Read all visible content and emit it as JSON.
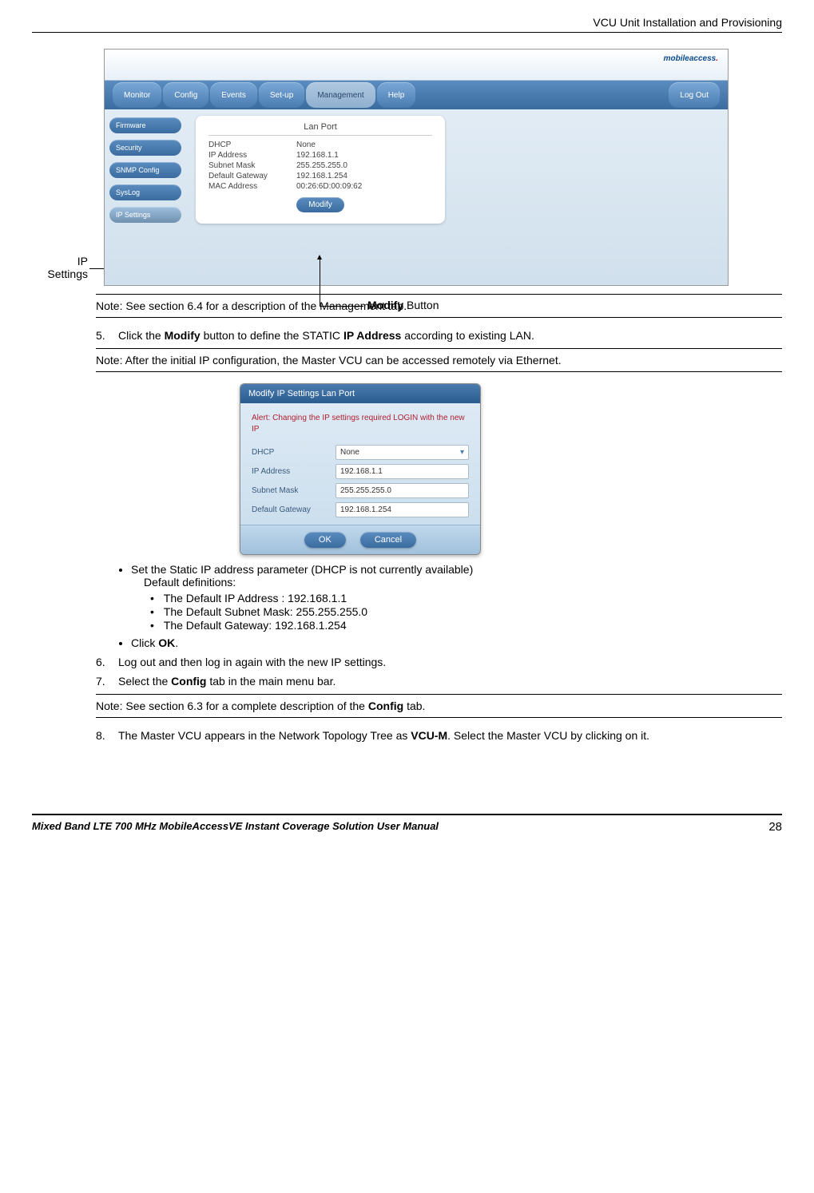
{
  "header": {
    "title": "VCU Unit Installation and Provisioning"
  },
  "figure1": {
    "label_ip": "IP\nSettings",
    "logo": "mobileaccess",
    "nav": {
      "monitor": "Monitor",
      "config": "Config",
      "events": "Events",
      "setup": "Set-up",
      "management": "Management",
      "help": "Help",
      "logout": "Log Out"
    },
    "sidebar": {
      "firmware": "Firmware",
      "security": "Security",
      "snmp": "SNMP Config",
      "syslog": "SysLog",
      "ipsettings": "IP Settings"
    },
    "lan_panel": {
      "title": "Lan Port",
      "rows": {
        "dhcp": {
          "k": "DHCP",
          "v": "None"
        },
        "ip": {
          "k": "IP Address",
          "v": "192.168.1.1"
        },
        "mask": {
          "k": "Subnet Mask",
          "v": "255.255.255.0"
        },
        "gw": {
          "k": "Default Gateway",
          "v": "192.168.1.254"
        },
        "mac": {
          "k": "MAC Address",
          "v": "00:26:6D:00:09:62"
        }
      },
      "modify": "Modify"
    },
    "modify_callout_bold": "Modify",
    "modify_callout_rest": " Button"
  },
  "note1": "Note: See section 6.4 for a description of the Management tab.",
  "step5": {
    "num": "5.",
    "prefix": "Click the ",
    "b1": "Modify",
    "mid": " button to define the STATIC ",
    "b2": "IP Address",
    "suffix": " according to existing LAN."
  },
  "note2": "Note: After the initial IP configuration, the Master VCU can be accessed remotely via Ethernet.",
  "dialog": {
    "title": "Modify IP Settings Lan Port",
    "alert": "Alert: Changing the IP settings required LOGIN with the new IP",
    "rows": {
      "dhcp": {
        "k": "DHCP",
        "v": "None"
      },
      "ip": {
        "k": "IP Address",
        "v": "192.168.1.1"
      },
      "mask": {
        "k": "Subnet Mask",
        "v": "255.255.255.0"
      },
      "gw": {
        "k": "Default Gateway",
        "v": "192.168.1.254"
      }
    },
    "ok": "OK",
    "cancel": "Cancel"
  },
  "bullets": {
    "set_static": "Set the Static IP address parameter (DHCP is not currently available)",
    "def_defs": "Default definitions:",
    "def_ip": "The Default IP Address : 192.168.1.1",
    "def_mask": "The Default Subnet Mask: 255.255.255.0",
    "def_gw": "The Default Gateway: 192.168.1.254",
    "click_prefix": "Click ",
    "click_bold": "OK",
    "click_suffix": "."
  },
  "step6": {
    "num": "6.",
    "txt": "Log out and then log in again with the new IP settings."
  },
  "step7": {
    "num": "7.",
    "prefix": "Select the ",
    "b1": "Config",
    "suffix": " tab in the main menu bar."
  },
  "note3_prefix": "Note: See section 6.3 for a complete description of the ",
  "note3_bold": "Config",
  "note3_suffix": " tab.",
  "step8": {
    "num": "8.",
    "prefix": "The Master VCU appears in the Network Topology Tree as ",
    "b1": "VCU-M",
    "suffix": ". Select the Master VCU by clicking on it."
  },
  "footer": {
    "title": "Mixed Band LTE 700 MHz MobileAccessVE Instant Coverage Solution User Manual",
    "page": "28"
  }
}
